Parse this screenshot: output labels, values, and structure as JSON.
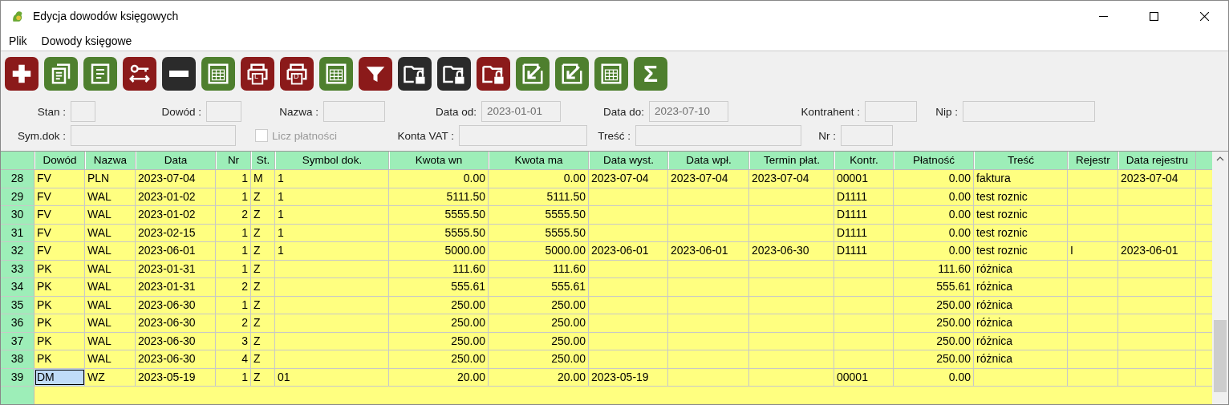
{
  "window": {
    "title": "Edycja dowodów księgowych"
  },
  "menu": [
    "Plik",
    "Dowody księgowe"
  ],
  "toolbar": [
    {
      "kind": "plus",
      "color": "#8b1a1a"
    },
    {
      "kind": "copy",
      "color": "#4e7f2e"
    },
    {
      "kind": "document",
      "color": "#4e7f2e"
    },
    {
      "kind": "swap",
      "color": "#8b1a1a"
    },
    {
      "kind": "minus",
      "color": "#2b2b2b"
    },
    {
      "kind": "table",
      "color": "#4e7f2e"
    },
    {
      "kind": "printer",
      "color": "#8b1a1a",
      "label": "L"
    },
    {
      "kind": "printer",
      "color": "#8b1a1a",
      "label": "D"
    },
    {
      "kind": "table",
      "color": "#4e7f2e"
    },
    {
      "kind": "filter",
      "color": "#8b1a1a"
    },
    {
      "kind": "lock",
      "color": "#2b2b2b"
    },
    {
      "kind": "lock",
      "color": "#2b2b2b"
    },
    {
      "kind": "lock",
      "color": "#8b1a1a"
    },
    {
      "kind": "export",
      "color": "#4e7f2e"
    },
    {
      "kind": "export",
      "color": "#4e7f2e"
    },
    {
      "kind": "table",
      "color": "#4e7f2e"
    },
    {
      "kind": "sigma",
      "color": "#4e7f2e",
      "label": "Σ"
    }
  ],
  "filters": [
    [
      {
        "kind": "field",
        "label": "Stan :"
      },
      {
        "kind": "field",
        "label": "Dowód :"
      },
      {
        "kind": "field",
        "label": "Nazwa :"
      },
      {
        "kind": "field",
        "label": "Data od:",
        "value": "2023-01-01"
      },
      {
        "kind": "field",
        "label": "Data do:",
        "value": "2023-07-10"
      },
      {
        "kind": "field",
        "label": "Kontrahent :"
      },
      {
        "kind": "field",
        "label": "Nip :"
      }
    ],
    [
      {
        "kind": "field",
        "label": "Sym.dok :"
      },
      {
        "kind": "checkbox",
        "label": "Licz płatności",
        "checked": false,
        "disabled": true
      },
      {
        "kind": "field",
        "label": "Konta VAT :"
      },
      {
        "kind": "field",
        "label": "Treść :"
      },
      {
        "kind": "field",
        "label": "Nr :"
      }
    ]
  ],
  "table": {
    "columns": [
      "Dowód",
      "Nazwa",
      "Data",
      "Nr",
      "St.",
      "Symbol dok.",
      "Kwota wn",
      "Kwota ma",
      "Data wyst.",
      "Data wpł.",
      "Termin płat.",
      "Kontr.",
      "Płatność",
      "Treść",
      "Rejestr",
      "Data rejestru"
    ],
    "rows": [
      {
        "num": "28",
        "selected": false,
        "cells": [
          "FV",
          "PLN",
          "2023-07-04",
          "1",
          "M",
          "1",
          "0.00",
          "0.00",
          "2023-07-04",
          "2023-07-04",
          "2023-07-04",
          "00001",
          "0.00",
          "faktura",
          "",
          "2023-07-04"
        ]
      },
      {
        "num": "29",
        "selected": false,
        "cells": [
          "FV",
          "WAL",
          "2023-01-02",
          "1",
          "Z",
          "1",
          "5111.50",
          "5111.50",
          "",
          "",
          "",
          "D1111",
          "0.00",
          "test roznic",
          "",
          ""
        ]
      },
      {
        "num": "30",
        "selected": false,
        "cells": [
          "FV",
          "WAL",
          "2023-01-02",
          "2",
          "Z",
          "1",
          "5555.50",
          "5555.50",
          "",
          "",
          "",
          "D1111",
          "0.00",
          "test roznic",
          "",
          ""
        ]
      },
      {
        "num": "31",
        "selected": false,
        "cells": [
          "FV",
          "WAL",
          "2023-02-15",
          "1",
          "Z",
          "1",
          "5555.50",
          "5555.50",
          "",
          "",
          "",
          "D1111",
          "0.00",
          "test roznic",
          "",
          ""
        ]
      },
      {
        "num": "32",
        "selected": false,
        "cells": [
          "FV",
          "WAL",
          "2023-06-01",
          "1",
          "Z",
          "1",
          "5000.00",
          "5000.00",
          "2023-06-01",
          "2023-06-01",
          "2023-06-30",
          "D1111",
          "0.00",
          "test roznic",
          "I",
          "2023-06-01"
        ]
      },
      {
        "num": "33",
        "selected": false,
        "cells": [
          "PK",
          "WAL",
          "2023-01-31",
          "1",
          "Z",
          "",
          "111.60",
          "111.60",
          "",
          "",
          "",
          "",
          "111.60",
          "różnica",
          "",
          ""
        ]
      },
      {
        "num": "34",
        "selected": false,
        "cells": [
          "PK",
          "WAL",
          "2023-01-31",
          "2",
          "Z",
          "",
          "555.61",
          "555.61",
          "",
          "",
          "",
          "",
          "555.61",
          "różnica",
          "",
          ""
        ]
      },
      {
        "num": "35",
        "selected": false,
        "cells": [
          "PK",
          "WAL",
          "2023-06-30",
          "1",
          "Z",
          "",
          "250.00",
          "250.00",
          "",
          "",
          "",
          "",
          "250.00",
          "różnica",
          "",
          ""
        ]
      },
      {
        "num": "36",
        "selected": false,
        "cells": [
          "PK",
          "WAL",
          "2023-06-30",
          "2",
          "Z",
          "",
          "250.00",
          "250.00",
          "",
          "",
          "",
          "",
          "250.00",
          "różnica",
          "",
          ""
        ]
      },
      {
        "num": "37",
        "selected": false,
        "cells": [
          "PK",
          "WAL",
          "2023-06-30",
          "3",
          "Z",
          "",
          "250.00",
          "250.00",
          "",
          "",
          "",
          "",
          "250.00",
          "różnica",
          "",
          ""
        ]
      },
      {
        "num": "38",
        "selected": false,
        "cells": [
          "PK",
          "WAL",
          "2023-06-30",
          "4",
          "Z",
          "",
          "250.00",
          "250.00",
          "",
          "",
          "",
          "",
          "250.00",
          "różnica",
          "",
          ""
        ]
      },
      {
        "num": "39",
        "selected": true,
        "cells": [
          "DM",
          "WZ",
          "2023-05-19",
          "1",
          "Z",
          "01",
          "20.00",
          "20.00",
          "2023-05-19",
          "",
          "",
          "00001",
          "0.00",
          "",
          "",
          ""
        ]
      }
    ]
  }
}
